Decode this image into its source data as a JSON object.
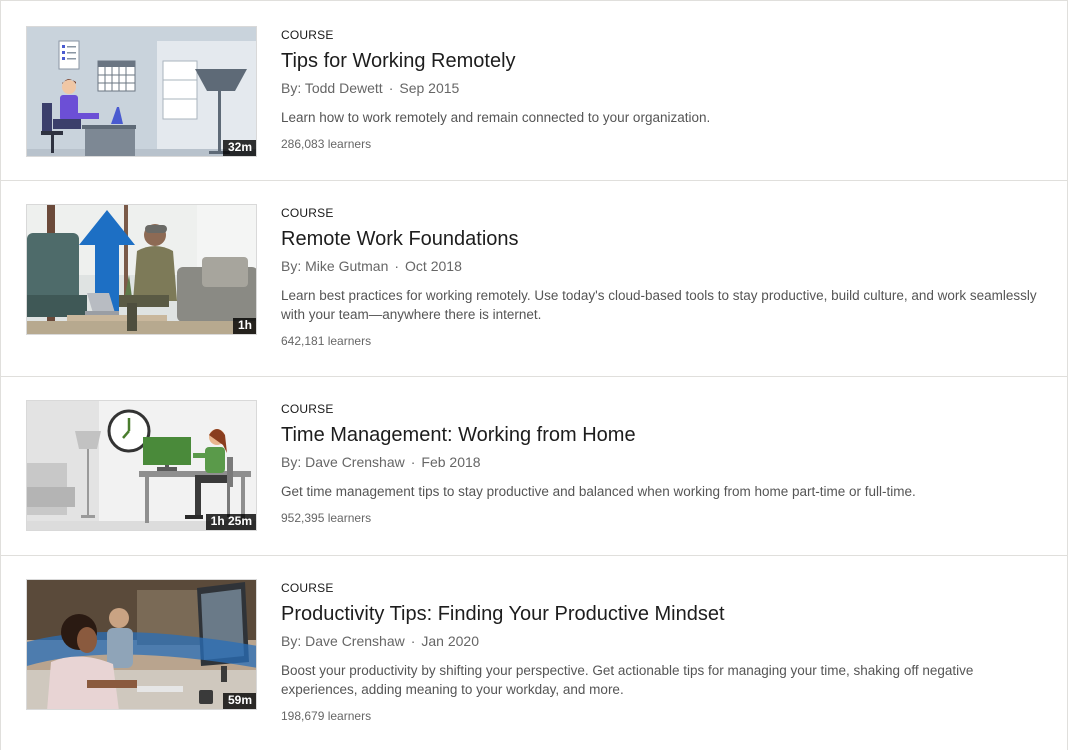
{
  "courses": [
    {
      "kind": "COURSE",
      "title": "Tips for Working Remotely",
      "author": "By: Todd Dewett",
      "separator": "·",
      "date": "Sep 2015",
      "description": "Learn how to work remotely and remain connected to your organization.",
      "learners": "286,083 learners",
      "duration": "32m"
    },
    {
      "kind": "COURSE",
      "title": "Remote Work Foundations",
      "author": "By: Mike Gutman",
      "separator": "·",
      "date": "Oct 2018",
      "description": "Learn best practices for working remotely. Use today's cloud-based tools to stay productive, build culture, and work seamlessly with your team—anywhere there is internet.",
      "learners": "642,181 learners",
      "duration": "1h"
    },
    {
      "kind": "COURSE",
      "title": "Time Management: Working from Home",
      "author": "By: Dave Crenshaw",
      "separator": "·",
      "date": "Feb 2018",
      "description": "Get time management tips to stay productive and balanced when working from home part-time or full-time.",
      "learners": "952,395 learners",
      "duration": "1h 25m"
    },
    {
      "kind": "COURSE",
      "title": "Productivity Tips: Finding Your Productive Mindset",
      "author": "By: Dave Crenshaw",
      "separator": "·",
      "date": "Jan 2020",
      "description": "Boost your productivity by shifting your perspective. Get actionable tips for managing your time, shaking off negative experiences, adding meaning to your workday, and more.",
      "learners": "198,679 learners",
      "duration": "59m"
    }
  ]
}
